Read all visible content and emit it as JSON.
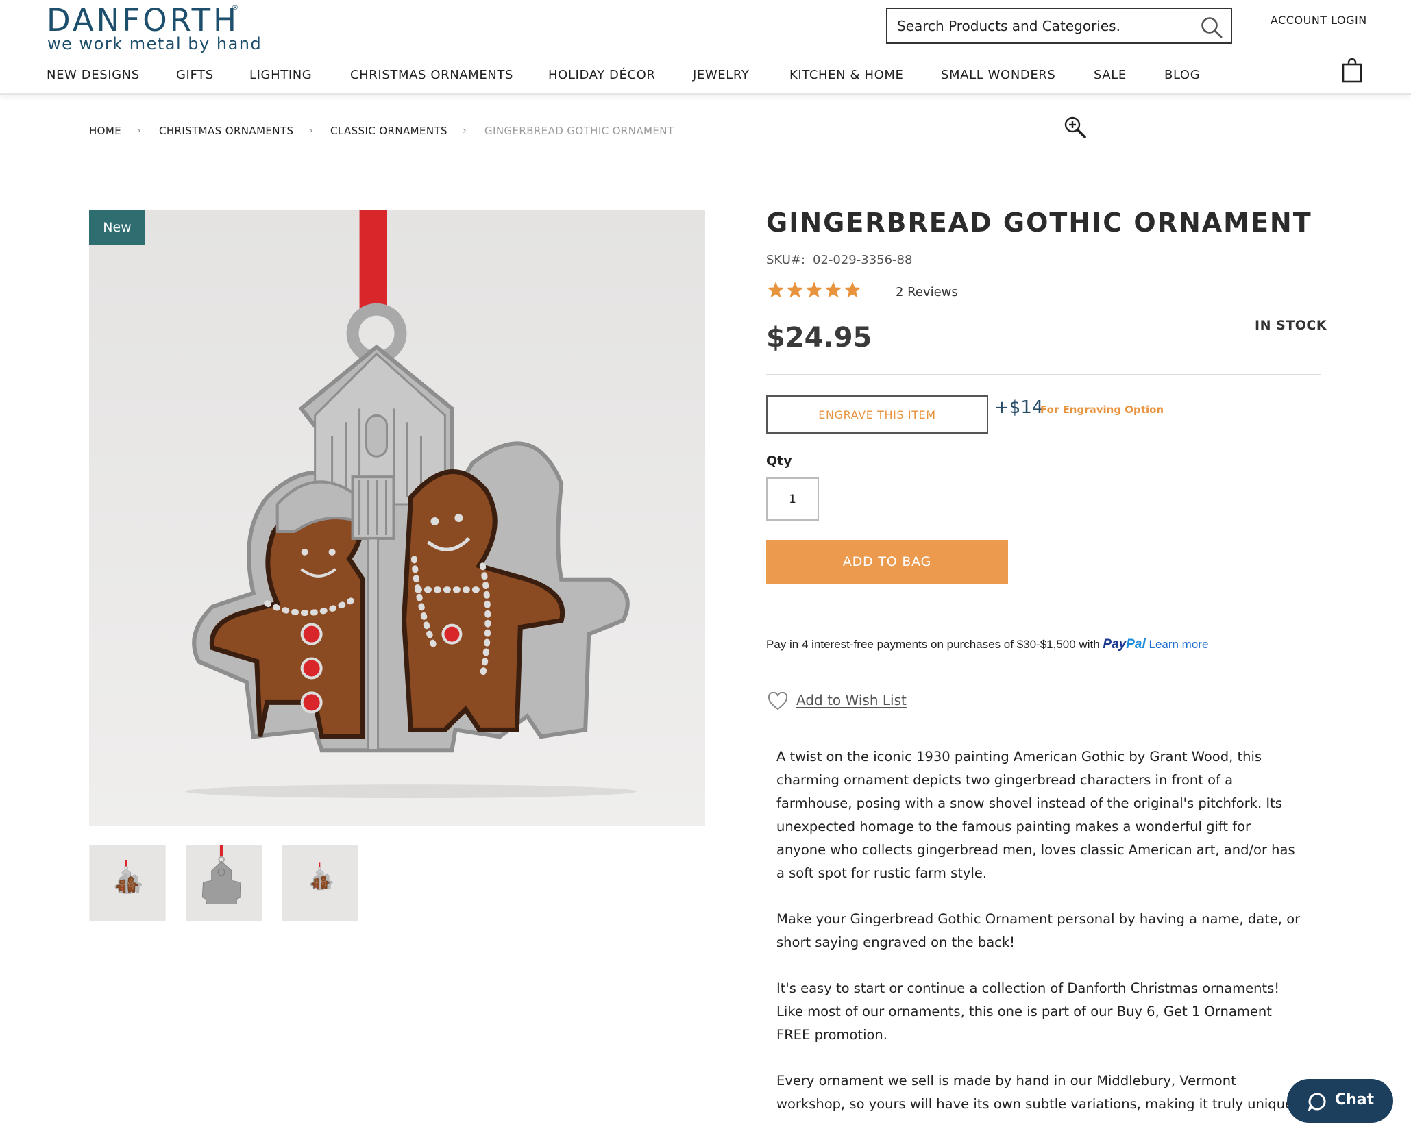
{
  "header": {
    "logo": {
      "name": "DANFORTH",
      "registered": "®",
      "tagline": "we work metal by hand"
    },
    "search": {
      "placeholder": "Search Products and Categories."
    },
    "account_login": "ACCOUNT LOGIN",
    "nav": [
      "NEW DESIGNS",
      "GIFTS",
      "LIGHTING",
      "CHRISTMAS ORNAMENTS",
      "HOLIDAY DÉCOR",
      "JEWELRY",
      "KITCHEN & HOME",
      "SMALL WONDERS",
      "SALE",
      "BLOG"
    ],
    "icons": [
      "search-icon",
      "shopping-bag-icon"
    ]
  },
  "breadcrumb": [
    "HOME",
    "CHRISTMAS ORNAMENTS",
    "CLASSIC ORNAMENTS",
    "GINGERBREAD GOTHIC ORNAMENT"
  ],
  "gallery": {
    "badge": "New",
    "thumbnail_count": 3,
    "icons": [
      "zoom-in-icon"
    ]
  },
  "product": {
    "title": "GINGERBREAD GOTHIC ORNAMENT",
    "sku_label": "SKU#:",
    "sku": "02-029-3356-88",
    "rating": 5,
    "reviews": "2 Reviews",
    "price": "$24.95",
    "stock": "IN STOCK",
    "engrave_button": "ENGRAVE THIS ITEM",
    "engrave_price": "+$14",
    "engrave_note": "For Engraving Option",
    "qty_label": "Qty",
    "qty_value": "1",
    "add_to_bag": "ADD TO BAG",
    "paypal": {
      "message": "Pay in 4 interest-free payments on purchases of $30-$1,500 with",
      "logo_pay": "Pay",
      "logo_pal": "Pal",
      "learn_more": "Learn more"
    },
    "wishlist": "Add to Wish List",
    "description": [
      "A twist on the iconic 1930 painting American Gothic by Grant Wood, this charming ornament depicts two gingerbread characters in front of a farmhouse, posing with a snow shovel instead of the original's pitchfork. Its unexpected homage to the famous painting makes a wonderful gift for anyone who collects gingerbread men, loves classic American art, and/or has a soft spot for rustic farm style.",
      "Make your Gingerbread Gothic Ornament personal by having a name, date, or short saying engraved on the back!",
      "It's easy to start or continue a collection of Danforth Christmas ornaments! Like most of our ornaments, this one is part of our Buy 6, Get 1 Ornament FREE promotion.",
      "Every ornament we sell is made by hand in our Middlebury, Vermont workshop, so yours will have its own subtle variations, making it truly unique."
    ]
  },
  "chat": {
    "label": "Chat"
  },
  "colors": {
    "brand": "#1d4e6b",
    "accent_orange": "#eb9a4e",
    "badge_teal": "#2e6e70",
    "chat_navy": "#1c3f5e",
    "ribbon_red": "#d8262b",
    "gingerbread_brown": "#8a4a22",
    "pewter": "#b9b9b9"
  }
}
